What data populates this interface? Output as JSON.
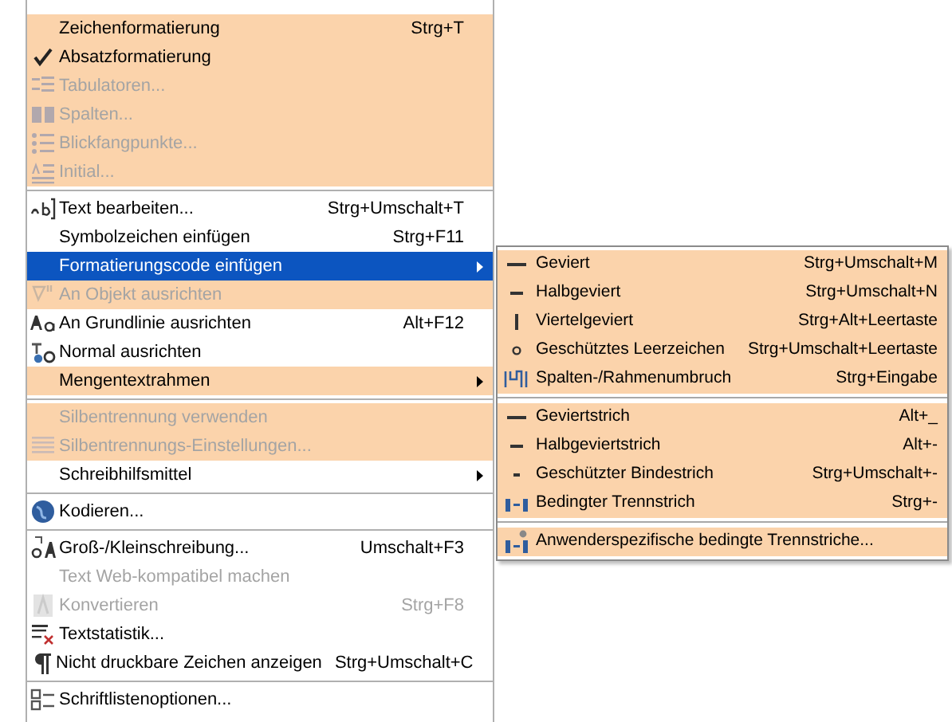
{
  "menu": {
    "groups": [
      [
        {
          "label": "Zeichenformatierung",
          "shortcut": "Strg+T",
          "checked": false,
          "disabled": false,
          "highlighted": true,
          "selected": false,
          "has_submenu": false
        },
        {
          "label": "Absatzformatierung",
          "checked": true,
          "disabled": false,
          "highlighted": true,
          "selected": false,
          "has_submenu": false
        },
        {
          "label": "Tabulatoren...",
          "checked": false,
          "disabled": true,
          "highlighted": true,
          "selected": false,
          "has_submenu": false
        },
        {
          "label": "Spalten...",
          "checked": false,
          "disabled": true,
          "highlighted": true,
          "selected": false,
          "has_submenu": false
        },
        {
          "label": "Blickfangpunkte...",
          "checked": false,
          "disabled": true,
          "highlighted": true,
          "selected": false,
          "has_submenu": false
        },
        {
          "label": "Initial...",
          "checked": false,
          "disabled": true,
          "highlighted": true,
          "selected": false,
          "has_submenu": false
        }
      ],
      [
        {
          "label": "Text bearbeiten...",
          "shortcut": "Strg+Umschalt+T",
          "checked": false,
          "disabled": false,
          "highlighted": false,
          "selected": false,
          "has_submenu": false
        },
        {
          "label": "Symbolzeichen einfügen",
          "shortcut": "Strg+F11",
          "checked": false,
          "disabled": false,
          "highlighted": false,
          "selected": false,
          "has_submenu": false
        },
        {
          "label": "Formatierungscode einfügen",
          "checked": false,
          "disabled": false,
          "highlighted": false,
          "selected": true,
          "has_submenu": true
        },
        {
          "label": "An Objekt ausrichten",
          "checked": false,
          "disabled": true,
          "highlighted": true,
          "selected": false,
          "has_submenu": false
        },
        {
          "label": "An Grundlinie ausrichten",
          "shortcut": "Alt+F12",
          "checked": false,
          "disabled": false,
          "highlighted": false,
          "selected": false,
          "has_submenu": false
        },
        {
          "label": "Normal ausrichten",
          "checked": false,
          "disabled": false,
          "highlighted": false,
          "selected": false,
          "has_submenu": false
        },
        {
          "label": "Mengentextrahmen",
          "checked": false,
          "disabled": false,
          "highlighted": true,
          "selected": false,
          "has_submenu": true
        }
      ],
      [
        {
          "label": "Silbentrennung verwenden",
          "checked": false,
          "disabled": true,
          "highlighted": true,
          "selected": false,
          "has_submenu": false
        },
        {
          "label": "Silbentrennungs-Einstellungen...",
          "checked": false,
          "disabled": true,
          "highlighted": true,
          "selected": false,
          "has_submenu": false
        },
        {
          "label": "Schreibhilfsmittel",
          "checked": false,
          "disabled": false,
          "highlighted": false,
          "selected": false,
          "has_submenu": true
        }
      ],
      [
        {
          "label": "Kodieren...",
          "checked": false,
          "disabled": false,
          "highlighted": false,
          "selected": false,
          "has_submenu": false
        }
      ],
      [
        {
          "label": "Groß-/Kleinschreibung...",
          "shortcut": "Umschalt+F3",
          "checked": false,
          "disabled": false,
          "highlighted": false,
          "selected": false,
          "has_submenu": false
        },
        {
          "label": "Text Web-kompatibel machen",
          "checked": false,
          "disabled": true,
          "highlighted": false,
          "selected": false,
          "has_submenu": false
        },
        {
          "label": "Konvertieren",
          "shortcut": "Strg+F8",
          "checked": false,
          "disabled": true,
          "highlighted": false,
          "selected": false,
          "has_submenu": false
        },
        {
          "label": "Textstatistik...",
          "checked": false,
          "disabled": false,
          "highlighted": false,
          "selected": false,
          "has_submenu": false
        },
        {
          "label": "Nicht druckbare Zeichen anzeigen",
          "shortcut": "Strg+Umschalt+C",
          "checked": false,
          "disabled": false,
          "highlighted": false,
          "selected": false,
          "has_submenu": false
        }
      ],
      [
        {
          "label": "Schriftlistenoptionen...",
          "checked": false,
          "disabled": false,
          "highlighted": false,
          "selected": false,
          "has_submenu": false
        }
      ]
    ]
  },
  "submenu": {
    "groups": [
      [
        {
          "label": "Geviert",
          "shortcut": "Strg+Umschalt+M",
          "highlighted": true
        },
        {
          "label": "Halbgeviert",
          "shortcut": "Strg+Umschalt+N",
          "highlighted": true
        },
        {
          "label": "Viertelgeviert",
          "shortcut": "Strg+Alt+Leertaste",
          "highlighted": true
        },
        {
          "label": "Geschütztes Leerzeichen",
          "shortcut": "Strg+Umschalt+Leertaste",
          "highlighted": true
        },
        {
          "label": "Spalten-/Rahmenumbruch",
          "shortcut": "Strg+Eingabe",
          "highlighted": true
        }
      ],
      [
        {
          "label": "Geviertstrich",
          "shortcut": "Alt+_",
          "highlighted": true
        },
        {
          "label": "Halbgeviertstrich",
          "shortcut": "Alt+-",
          "highlighted": true
        },
        {
          "label": "Geschützter Bindestrich",
          "shortcut": "Strg+Umschalt+-",
          "highlighted": true
        },
        {
          "label": "Bedingter Trennstrich",
          "shortcut": "Strg+-",
          "highlighted": true
        }
      ],
      [
        {
          "label": "Anwenderspezifische bedingte Trennstriche...",
          "highlighted": true
        }
      ]
    ]
  }
}
